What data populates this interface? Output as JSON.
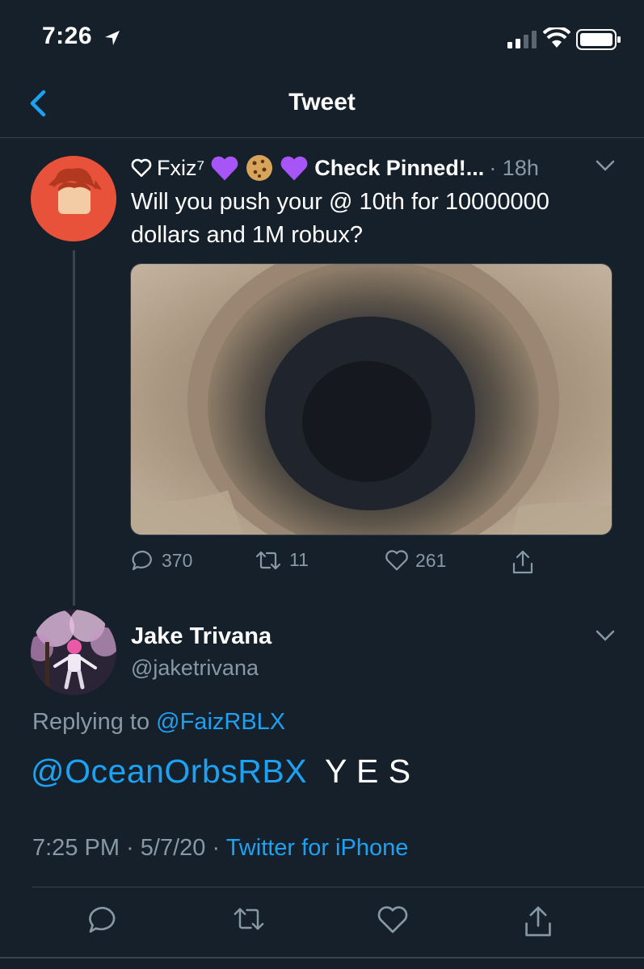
{
  "status_bar": {
    "time": "7:26"
  },
  "nav": {
    "title": "Tweet"
  },
  "quoted_tweet": {
    "name_prefix": "Fxiz⁷",
    "name_suffix": "Check Pinned!...",
    "time": "· 18h",
    "text": "Will you push your @ 10th for 10000000 dollars and 1M robux?",
    "replies": "370",
    "retweets": "11",
    "likes": "261"
  },
  "tweet": {
    "name": "Jake Trivana",
    "handle": "@jaketrivana",
    "replying_label": "Replying to",
    "replying_handle": "@FaizRBLX",
    "mention": "@OceanOrbsRBX",
    "text": "Y E S",
    "time": "7:25 PM",
    "date": "5/7/20",
    "source": "Twitter for iPhone"
  },
  "colors": {
    "background": "#15202b",
    "accent": "#1da1f2",
    "muted": "#8899a6",
    "divider": "#38444d",
    "avatar_bg": "#e8523a"
  }
}
